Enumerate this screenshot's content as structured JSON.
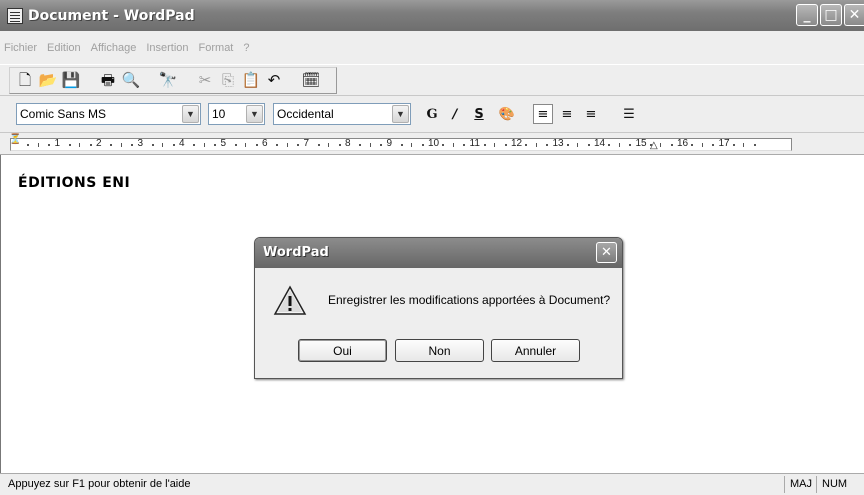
{
  "window": {
    "title": "Document - WordPad"
  },
  "menu": [
    "Fichier",
    "Edition",
    "Affichage",
    "Insertion",
    "Format",
    "?"
  ],
  "toolbar": {
    "buttons": [
      {
        "name": "new-icon",
        "glyph": "🗋"
      },
      {
        "name": "open-icon",
        "glyph": "📂"
      },
      {
        "name": "save-icon",
        "glyph": "💾"
      },
      {
        "name": "print-icon",
        "glyph": "🖶"
      },
      {
        "name": "print-preview-icon",
        "glyph": "🔍"
      },
      {
        "name": "find-icon",
        "glyph": "🔭"
      },
      {
        "name": "cut-icon",
        "glyph": "✂"
      },
      {
        "name": "copy-icon",
        "glyph": "⎘"
      },
      {
        "name": "paste-icon",
        "glyph": "📋"
      },
      {
        "name": "undo-icon",
        "glyph": "↶"
      },
      {
        "name": "insert-datetime-icon",
        "glyph": "🗓"
      }
    ]
  },
  "format": {
    "font": "Comic Sans MS",
    "size": "10",
    "script": "Occidental",
    "bold": "G",
    "italic": "I",
    "underline": "S",
    "color_icon": "🎨",
    "align_left": "≡",
    "align_center": "≡",
    "align_right": "≡",
    "bullets": "☰"
  },
  "ruler": {
    "numbers": [
      "1",
      "2",
      "3",
      "4",
      "5",
      "6",
      "7",
      "8",
      "9",
      "10",
      "11",
      "12",
      "13",
      "14",
      "15",
      "16",
      "17"
    ]
  },
  "document": {
    "text": "ÉDITIONS ENI"
  },
  "status": {
    "help": "Appuyez sur F1 pour obtenir de l'aide",
    "caps": "MAJ",
    "num": "NUM"
  },
  "dialog": {
    "title": "WordPad",
    "message": "Enregistrer les modifications apportées à Document?",
    "buttons": {
      "yes": "Oui",
      "no": "Non",
      "cancel": "Annuler"
    }
  }
}
